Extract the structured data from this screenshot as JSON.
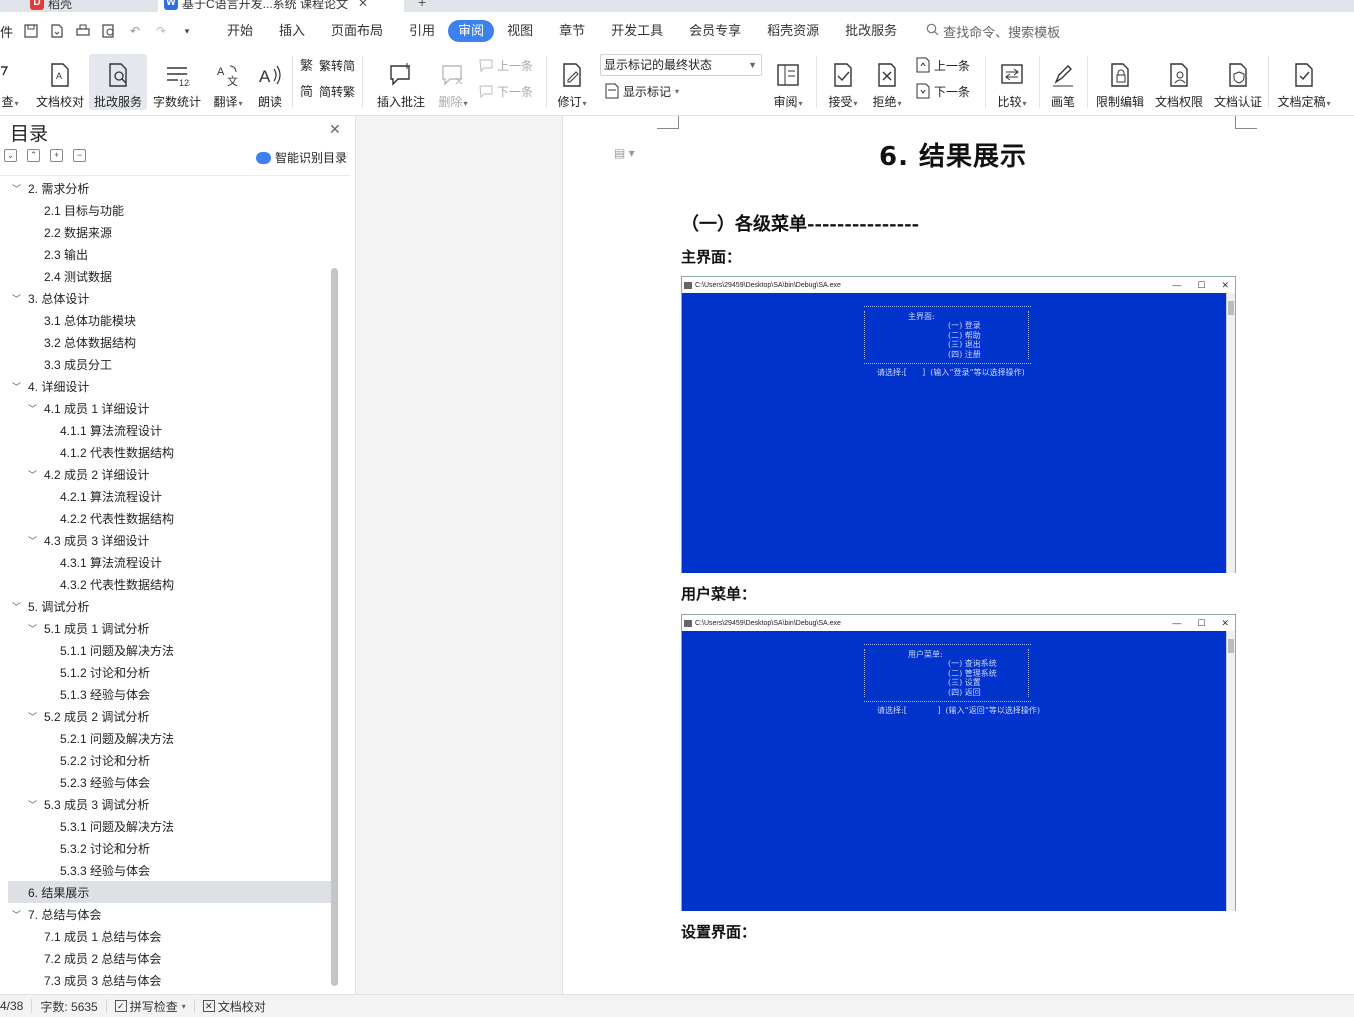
{
  "tabs": [
    {
      "label": "稻壳",
      "icon": "wps-docer-icon"
    },
    {
      "label": "基于C语言开发...系统 课程论文",
      "icon": "wps-writer-icon"
    }
  ],
  "menu": {
    "items": [
      "开始",
      "插入",
      "页面布局",
      "引用",
      "审阅",
      "视图",
      "章节",
      "开发工具",
      "会员专享",
      "稻壳资源",
      "批改服务"
    ],
    "active": "审阅",
    "search_placeholder": "查找命令、搜索模板",
    "file_label": "件"
  },
  "ribbon": {
    "spellcheck": "查",
    "doc_check": "文档校对",
    "correction_service": "批改服务",
    "word_count": "字数统计",
    "translate": "翻译",
    "read_aloud": "朗读",
    "trad_to_simp": "繁转简",
    "simp_to_trad": "简转繁",
    "insert_comment": "插入批注",
    "delete": "删除",
    "prev": "上一条",
    "next": "下一条",
    "revise": "修订",
    "markup_select": "显示标记的最终状态",
    "show_markup": "显示标记",
    "review": "审阅",
    "accept": "接受",
    "reject": "拒绝",
    "prev2": "上一条",
    "next2": "下一条",
    "compare": "比较",
    "pen": "画笔",
    "restrict_edit": "限制编辑",
    "doc_permission": "文档权限",
    "doc_auth": "文档认证",
    "doc_finalize": "文档定稿"
  },
  "sidebar": {
    "title": "目录",
    "ai_toc": "智能识别目录",
    "toc": [
      {
        "label": "2.  需求分析",
        "level": 1,
        "expanded": true
      },
      {
        "label": "2.1  目标与功能",
        "level": 2
      },
      {
        "label": "2.2  数据来源",
        "level": 2
      },
      {
        "label": "2.3  输出",
        "level": 2
      },
      {
        "label": "2.4 测试数据",
        "level": 2
      },
      {
        "label": "3.  总体设计",
        "level": 1,
        "expanded": true
      },
      {
        "label": "3.1  总体功能模块",
        "level": 2
      },
      {
        "label": "3.2  总体数据结构",
        "level": 2
      },
      {
        "label": "3.3  成员分工",
        "level": 2
      },
      {
        "label": "4.  详细设计",
        "level": 1,
        "expanded": true
      },
      {
        "label": "4.1  成员 1 详细设计",
        "level": 2,
        "expanded": true
      },
      {
        "label": "4.1.1  算法流程设计",
        "level": 3
      },
      {
        "label": "4.1.2  代表性数据结构",
        "level": 3
      },
      {
        "label": "4.2  成员 2 详细设计",
        "level": 2,
        "expanded": true
      },
      {
        "label": "4.2.1  算法流程设计",
        "level": 3
      },
      {
        "label": "4.2.2  代表性数据结构",
        "level": 3
      },
      {
        "label": "4.3  成员 3 详细设计",
        "level": 2,
        "expanded": true
      },
      {
        "label": "4.3.1  算法流程设计",
        "level": 3
      },
      {
        "label": "4.3.2  代表性数据结构",
        "level": 3
      },
      {
        "label": "5.  调试分析",
        "level": 1,
        "expanded": true
      },
      {
        "label": "5.1  成员 1 调试分析",
        "level": 2,
        "expanded": true
      },
      {
        "label": "5.1.1  问题及解决方法",
        "level": 3
      },
      {
        "label": "5.1.2  讨论和分析",
        "level": 3
      },
      {
        "label": "5.1.3  经验与体会",
        "level": 3
      },
      {
        "label": "5.2  成员 2 调试分析",
        "level": 2,
        "expanded": true
      },
      {
        "label": "5.2.1  问题及解决方法",
        "level": 3
      },
      {
        "label": "5.2.2  讨论和分析",
        "level": 3
      },
      {
        "label": "5.2.3  经验与体会",
        "level": 3
      },
      {
        "label": "5.3  成员 3 调试分析",
        "level": 2,
        "expanded": true
      },
      {
        "label": "5.3.1  问题及解决方法",
        "level": 3
      },
      {
        "label": "5.3.2  讨论和分析",
        "level": 3
      },
      {
        "label": "5.3.3  经验与体会",
        "level": 3
      },
      {
        "label": "6.  结果展示",
        "level": 1,
        "selected": true
      },
      {
        "label": "7.  总结与体会",
        "level": 1,
        "expanded": true
      },
      {
        "label": "7.1  成员 1 总结与体会",
        "level": 2
      },
      {
        "label": "7.2  成员 2 总结与体会",
        "level": 2
      },
      {
        "label": "7.3  成员 3 总结与体会",
        "level": 2
      }
    ]
  },
  "document": {
    "heading": "6.  结果展示",
    "subheading": "（一）各级菜单---------------",
    "caption1": "主界面：",
    "caption2": "用户菜单：",
    "caption3": "设置界面：",
    "console1": {
      "title": "C:\\Users\\29459\\Desktop\\SA\\bin\\Debug\\SA.exe",
      "heading": "主界面:",
      "options": [
        "(一) 登录",
        "(二) 帮助",
        "(三) 退出",
        "(四) 注册"
      ],
      "prompt": "请选择:[      ]  (输入“登录”等以选择操作)"
    },
    "console2": {
      "title": "C:\\Users\\29459\\Desktop\\SA\\bin\\Debug\\SA.exe",
      "heading": "用户菜单:",
      "options": [
        "(一) 查询系统",
        "(二) 管理系统",
        "(三) 设置",
        "(四) 返回"
      ],
      "prompt": "请选择:[            ]  (输入“返回”等以选择操作)"
    },
    "window_buttons": [
      "—",
      "☐",
      "✕"
    ]
  },
  "status": {
    "page": "4/38",
    "word_count": "字数: 5635",
    "spellcheck": "拼写检查",
    "doc_check": "文档校对"
  },
  "colors": {
    "accent": "#3d80f0",
    "console_bg": "#0033cc",
    "selected_toc": "#dde1e6"
  }
}
